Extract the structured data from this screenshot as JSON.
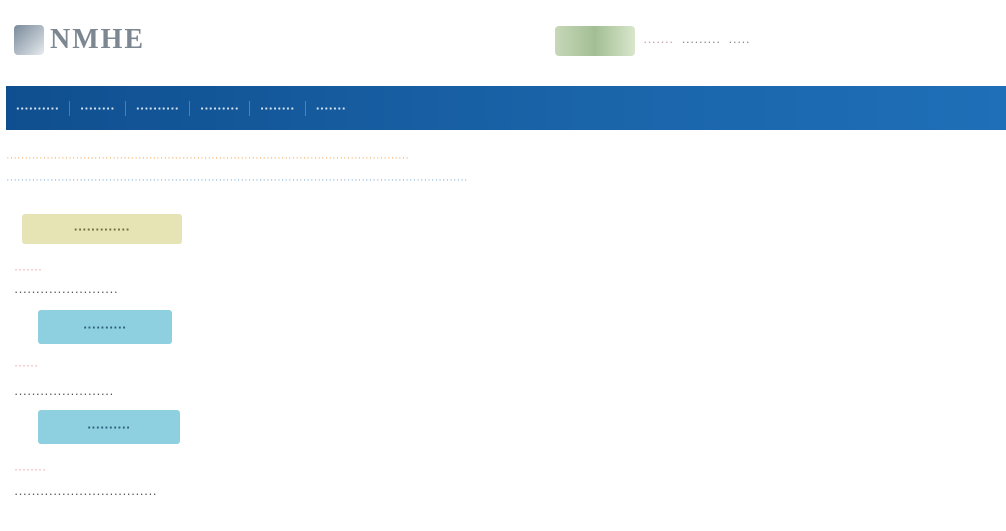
{
  "header": {
    "logo_text": "NMHE",
    "link1": "·······",
    "link2": "·········",
    "link3": "·····"
  },
  "nav": {
    "items": [
      "··········",
      "········",
      "··········",
      "·········",
      "········",
      "·······"
    ]
  },
  "notice": {
    "primary": "··············································································································",
    "secondary": "······························································································································"
  },
  "sections": {
    "top_button": "·············",
    "label1": "·······",
    "line1": "························",
    "button1": "··········",
    "label2": "······",
    "line2": "·······················",
    "button2": "··········",
    "label3": "········",
    "line3": "·································"
  },
  "colors": {
    "navbar": "#1a63a8",
    "notice": "#f0b060",
    "button_yellow": "#e6e4b4",
    "button_blue": "#8fd0e0"
  }
}
